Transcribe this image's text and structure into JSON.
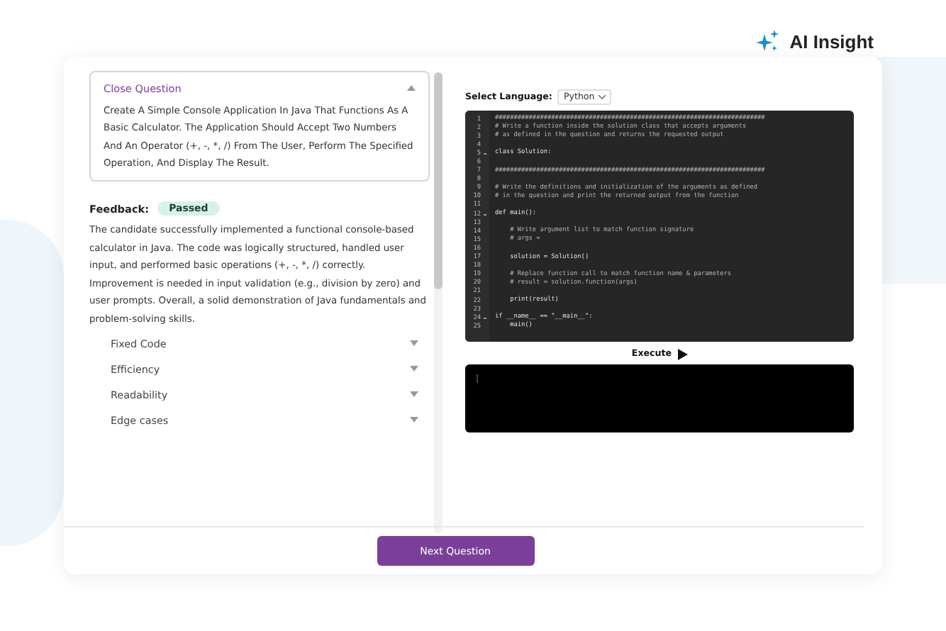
{
  "brand": {
    "name": "AI Insight"
  },
  "question": {
    "title": "Close Question",
    "expanded": true,
    "text": "Create A Simple Console Application In Java That Functions As A Basic Calculator. The Application Should Accept Two Numbers And An Operator (+, -, *, /) From The User, Perform The Specified Operation, And Display The Result."
  },
  "feedback": {
    "label": "Feedback:",
    "status": "Passed",
    "text": "The candidate successfully implemented a functional console-based calculator in Java. The code was logically structured, handled user input, and performed basic operations (+, -, *, /) correctly. Improvement is needed in input validation (e.g., division by zero) and user prompts. Overall, a solid demonstration of Java fundamentals and problem-solving skills."
  },
  "sections": [
    {
      "label": "Fixed Code",
      "expanded": false
    },
    {
      "label": "Efficiency",
      "expanded": false
    },
    {
      "label": "Readability",
      "expanded": false
    },
    {
      "label": "Edge cases",
      "expanded": false
    }
  ],
  "language": {
    "label": "Select Language:",
    "value": "Python"
  },
  "code_lines": [
    {
      "number": "1",
      "text": "########################################################################",
      "kind": "comment",
      "foldable": false
    },
    {
      "number": "2",
      "text": "# Write a function inside the solution class that accepts arguments",
      "kind": "comment",
      "foldable": false
    },
    {
      "number": "3",
      "text": "# as defined in the question and returns the requested output",
      "kind": "comment",
      "foldable": false
    },
    {
      "number": "4",
      "kind": "code",
      "foldable": false
    },
    {
      "number": "5",
      "text": "class Solution:",
      "kind": "code",
      "foldable": true
    },
    {
      "number": "6",
      "kind": "code",
      "foldable": false
    },
    {
      "number": "7",
      "text": "########################################################################",
      "kind": "comment",
      "foldable": false
    },
    {
      "number": "8",
      "kind": "code",
      "foldable": false
    },
    {
      "number": "9",
      "text": "# Write the definitions and initialization of the arguments as defined",
      "kind": "comment",
      "foldable": false
    },
    {
      "number": "10",
      "text": "# in the question and print the returned output from the function",
      "kind": "comment",
      "foldable": false
    },
    {
      "number": "11",
      "kind": "code",
      "foldable": false
    },
    {
      "number": "12",
      "text": "def main():",
      "kind": "code",
      "foldable": true
    },
    {
      "number": "13",
      "kind": "code",
      "foldable": false
    },
    {
      "number": "14",
      "text": "    # Write argument list to match function signature",
      "kind": "comment",
      "foldable": false
    },
    {
      "number": "15",
      "text": "    # args =",
      "kind": "comment",
      "foldable": false
    },
    {
      "number": "16",
      "kind": "code",
      "foldable": false
    },
    {
      "number": "17",
      "text": "    solution = Solution()",
      "kind": "code",
      "foldable": false
    },
    {
      "number": "18",
      "kind": "code",
      "foldable": false
    },
    {
      "number": "19",
      "text": "    # Replace function call to match function name & parameters",
      "kind": "comment",
      "foldable": false
    },
    {
      "number": "20",
      "text": "    # result = solution.function(args)",
      "kind": "comment",
      "foldable": false
    },
    {
      "number": "21",
      "kind": "code",
      "foldable": false
    },
    {
      "number": "22",
      "text": "    print(result)",
      "kind": "code",
      "foldable": false
    },
    {
      "number": "23",
      "kind": "code",
      "foldable": false
    },
    {
      "number": "24",
      "text": "if __name__ == \"__main__\":",
      "kind": "code",
      "foldable": true
    },
    {
      "number": "25",
      "text": "    main()",
      "kind": "code",
      "foldable": false
    }
  ],
  "execute": {
    "label": "Execute"
  },
  "next_button": {
    "label": "Next Question"
  }
}
